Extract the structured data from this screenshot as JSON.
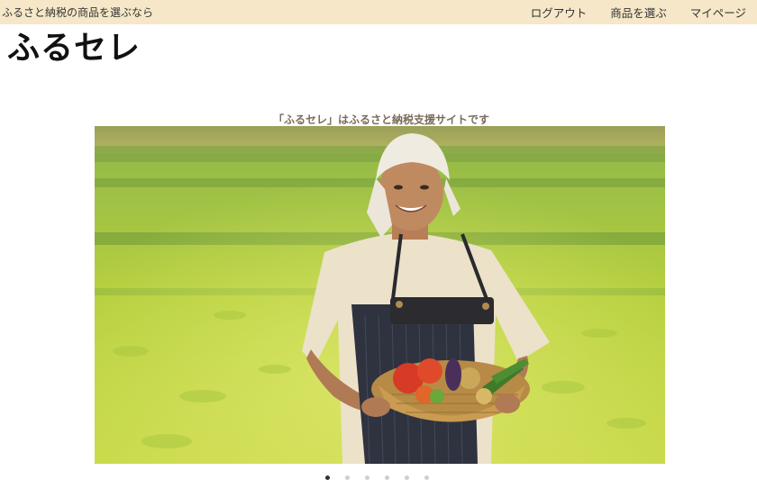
{
  "header": {
    "tagline": "ふるさと納税の商品を選ぶなら",
    "nav": [
      {
        "label": "ログアウト"
      },
      {
        "label": "商品を選ぶ"
      },
      {
        "label": "マイページ"
      }
    ],
    "background_color": "#f6e7c8"
  },
  "logo": {
    "text": "ふるセレ",
    "highlight_color": "#fbf33c"
  },
  "hero": {
    "caption": "「ふるセレ」はふるさと納税支援サイトです"
  },
  "carousel": {
    "slide_count": 6,
    "active_index": 0
  }
}
